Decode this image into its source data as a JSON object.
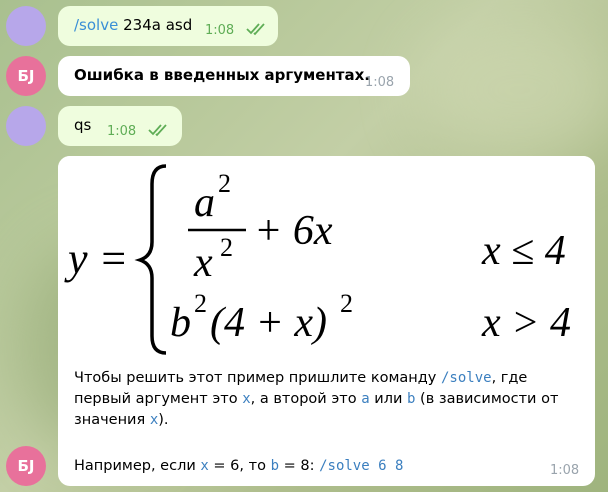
{
  "messages": [
    {
      "command": "/solve",
      "args": "234a asd",
      "time": "1:08"
    },
    {
      "avatar": "БЈ",
      "text": "Ошибка в введенных аргументах.",
      "time": "1:08"
    },
    {
      "text": "qs",
      "time": "1:08"
    },
    {
      "avatar": "БЈ",
      "time": "1:08",
      "formula": {
        "lhs": "y =",
        "case1_num_base": "a",
        "case1_num_exp": "2",
        "case1_den_base": "x",
        "case1_den_exp": "2",
        "case1_tail": "+ 6x",
        "case1_cond": "x ≤ 4",
        "case2_b": "b",
        "case2_b_exp": "2",
        "case2_paren": "(4 + x)",
        "case2_paren_exp": "2",
        "case2_cond": "x > 4"
      },
      "desc": {
        "p1": "Чтобы решить этот пример пришлите команду ",
        "c1": "/solve",
        "p2": ", где первый аргумент это ",
        "c2": "x",
        "p3": ", а второй это ",
        "c3": "a",
        "p4": " или ",
        "c4": "b",
        "p5": " (в зависимости от значения ",
        "c5": "x",
        "p6": ")."
      },
      "example": {
        "p1": "Например, если ",
        "c1": "x",
        "p2": " = 6, то ",
        "c2": "b",
        "p3": " = 8: ",
        "c3": "/solve 6 8"
      }
    }
  ]
}
